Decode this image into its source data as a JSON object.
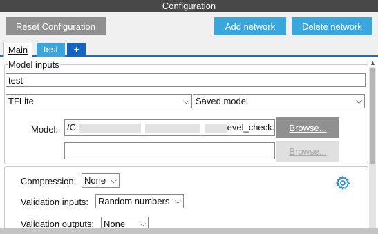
{
  "window": {
    "title": "Configuration"
  },
  "toolbar": {
    "reset_label": "Reset Configuration",
    "add_label": "Add network",
    "delete_label": "Delete network"
  },
  "tabs": [
    {
      "label": "Main",
      "active": false
    },
    {
      "label": "test",
      "active": true
    },
    {
      "label": "+",
      "active": false
    }
  ],
  "model_inputs": {
    "legend": "Model inputs",
    "name_value": "test",
    "framework": "TFLite",
    "model_type": "Saved model",
    "model_label": "Model:",
    "path_start": "/C:",
    "path_end": "evel_check.tflite",
    "path2_value": "",
    "browse_label": "Browse...",
    "browse2_label": "Browse..."
  },
  "settings": {
    "compression_label": "Compression:",
    "compression_value": "None",
    "validation_inputs_label": "Validation inputs:",
    "validation_inputs_value": "Random numbers",
    "validation_outputs_label": "Validation outputs:",
    "validation_outputs_value": "None"
  },
  "icons": {
    "gear": "gear-icon",
    "chevron": "chevron-down-icon",
    "scroll_up": "scroll-up-arrow"
  },
  "colors": {
    "accent_blue": "#3aa6dc",
    "tab_plus_blue": "#1565c0",
    "button_grey": "#909090",
    "titlebar": "#484848"
  }
}
